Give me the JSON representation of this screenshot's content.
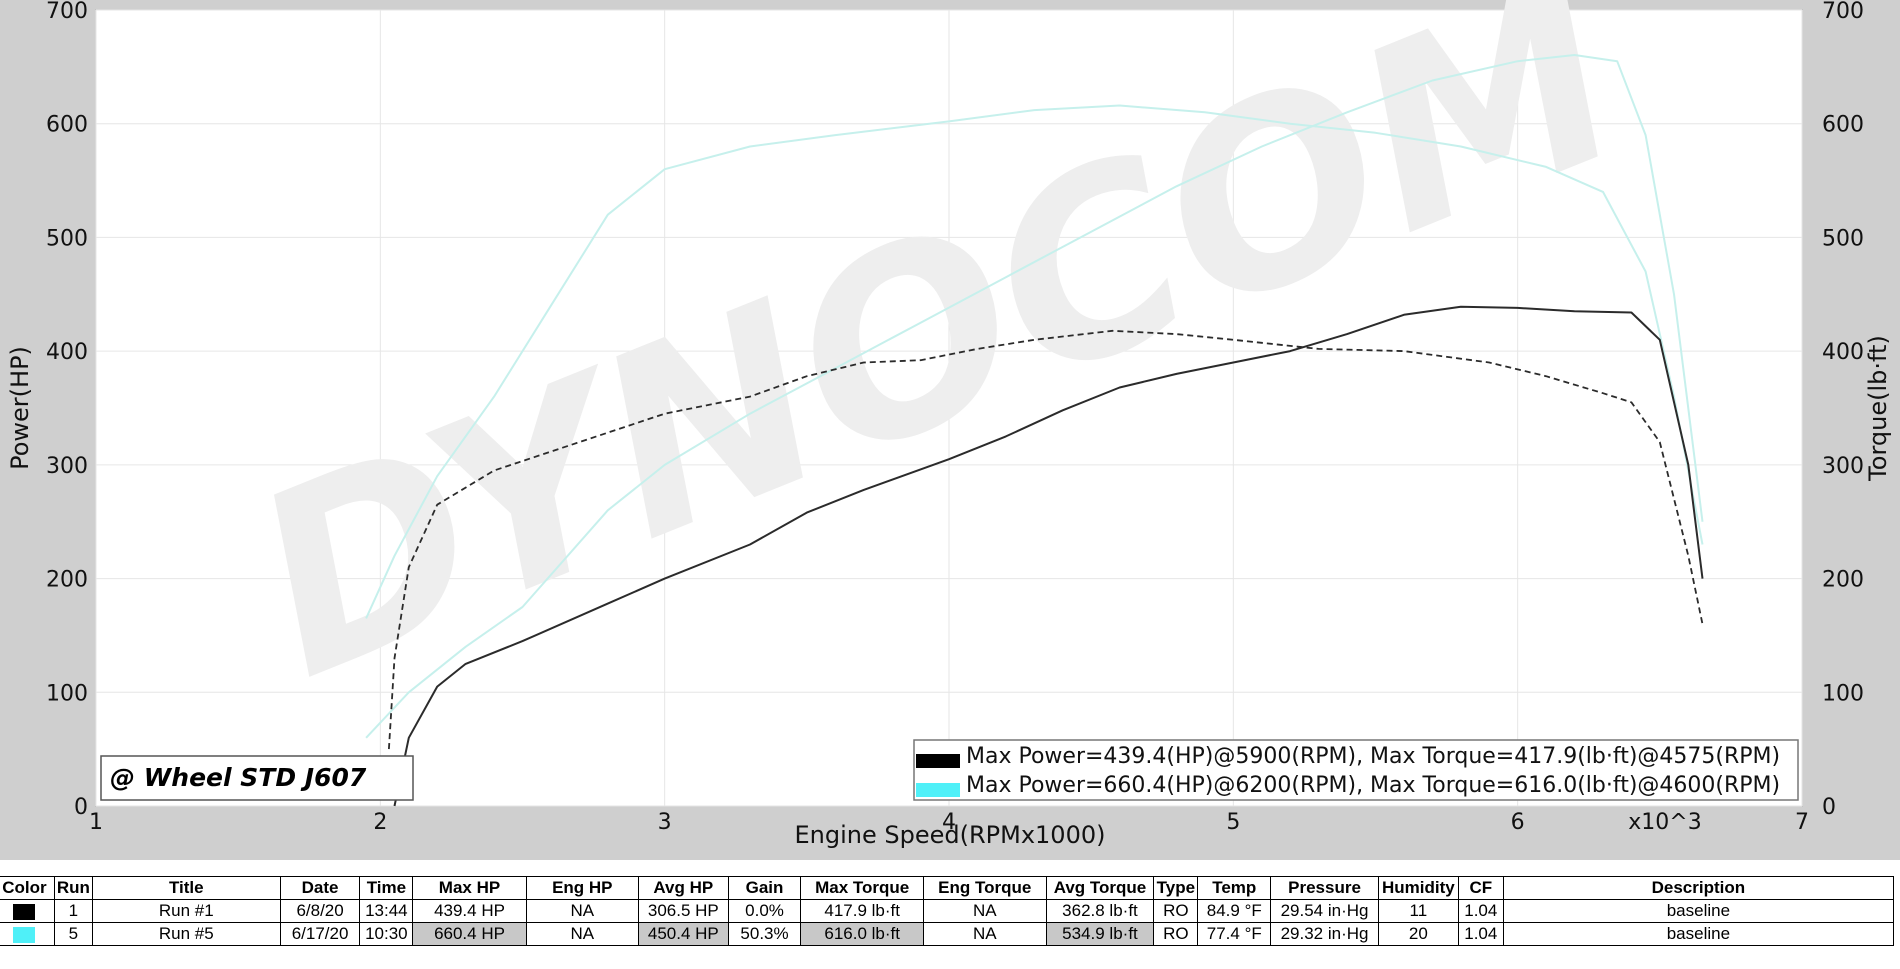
{
  "chart_data": {
    "type": "line",
    "title": "",
    "xlabel": "Engine Speed(RPMx1000)",
    "x_multiplier_label": "x10^3",
    "ylabel_left": "Power(HP)",
    "ylabel_right": "Torque(lb·ft)",
    "xlim": [
      1,
      7
    ],
    "ylim": [
      0,
      700
    ],
    "x_ticks": [
      "1",
      "2",
      "3",
      "4",
      "5",
      "6",
      "7"
    ],
    "y_ticks": [
      "0",
      "100",
      "200",
      "300",
      "400",
      "500",
      "600",
      "700"
    ],
    "grid": true,
    "watermark": "DYNOCOM",
    "corner_label": "@ Wheel STD J607",
    "legend_position": "bottom-right",
    "series": [
      {
        "name": "Run #1 Power (HP)",
        "color": "#2b2b2b",
        "style": "solid",
        "x": [
          2.05,
          2.1,
          2.2,
          2.3,
          2.5,
          2.8,
          3.0,
          3.3,
          3.5,
          3.7,
          4.0,
          4.2,
          4.4,
          4.6,
          4.8,
          5.0,
          5.2,
          5.4,
          5.6,
          5.8,
          6.0,
          6.2,
          6.4,
          6.5,
          6.6,
          6.65
        ],
        "y": [
          0,
          60,
          105,
          125,
          145,
          178,
          200,
          230,
          258,
          278,
          305,
          325,
          348,
          368,
          380,
          390,
          400,
          415,
          432,
          439,
          438,
          435,
          434,
          410,
          300,
          200
        ]
      },
      {
        "name": "Run #1 Torque (lb·ft)",
        "color": "#2b2b2b",
        "style": "dashed",
        "x": [
          2.03,
          2.05,
          2.1,
          2.2,
          2.4,
          2.7,
          3.0,
          3.3,
          3.5,
          3.7,
          3.9,
          4.1,
          4.3,
          4.575,
          4.8,
          5.0,
          5.3,
          5.6,
          5.9,
          6.1,
          6.3,
          6.4,
          6.5,
          6.6,
          6.65
        ],
        "y": [
          50,
          130,
          210,
          265,
          295,
          320,
          345,
          360,
          378,
          390,
          392,
          402,
          410,
          417.9,
          415,
          410,
          402,
          400,
          390,
          378,
          363,
          355,
          320,
          220,
          160
        ]
      },
      {
        "name": "Run #5 Power (HP)",
        "color": "#c6f0ec",
        "style": "solid",
        "x": [
          1.95,
          2.1,
          2.3,
          2.5,
          2.8,
          3.0,
          3.3,
          3.6,
          3.9,
          4.2,
          4.5,
          4.8,
          5.1,
          5.4,
          5.7,
          6.0,
          6.2,
          6.35,
          6.45,
          6.55,
          6.65
        ],
        "y": [
          60,
          100,
          140,
          175,
          260,
          300,
          345,
          385,
          425,
          465,
          505,
          545,
          580,
          610,
          638,
          655,
          660.4,
          655,
          590,
          450,
          250
        ]
      },
      {
        "name": "Run #5 Torque (lb·ft)",
        "color": "#c6f0ec",
        "style": "solid",
        "x": [
          1.95,
          2.05,
          2.2,
          2.4,
          2.6,
          2.8,
          3.0,
          3.3,
          3.6,
          4.0,
          4.3,
          4.6,
          4.9,
          5.2,
          5.5,
          5.8,
          6.1,
          6.3,
          6.45,
          6.55,
          6.65
        ],
        "y": [
          165,
          220,
          290,
          360,
          440,
          520,
          560,
          580,
          590,
          602,
          612,
          616,
          610,
          600,
          592,
          580,
          562,
          540,
          470,
          360,
          230
        ]
      }
    ],
    "legend_entries": [
      {
        "color": "#000000",
        "text": "Max Power=439.4(HP)@5900(RPM), Max Torque=417.9(lb·ft)@4575(RPM)"
      },
      {
        "color": "#4ff0f8",
        "text": "Max Power=660.4(HP)@6200(RPM), Max Torque=616.0(lb·ft)@4600(RPM)"
      }
    ]
  },
  "table": {
    "headers": [
      "Color",
      "Run",
      "Title",
      "Date",
      "Time",
      "Max HP",
      "Eng HP",
      "Avg HP",
      "Gain",
      "Max Torque",
      "Eng Torque",
      "Avg Torque",
      "Type",
      "Temp",
      "Pressure",
      "Humidity",
      "CF",
      "Description"
    ],
    "rows": [
      {
        "color": "#000000",
        "run": "1",
        "title": "Run #1",
        "date": "6/8/20",
        "time": "13:44",
        "max_hp": "439.4 HP",
        "eng_hp": "NA",
        "avg_hp": "306.5 HP",
        "gain": "0.0%",
        "max_torque": "417.9 lb·ft",
        "eng_torque": "NA",
        "avg_torque": "362.8 lb·ft",
        "type": "RO",
        "temp": "84.9 °F",
        "pressure": "29.54 in·Hg",
        "humidity": "11",
        "cf": "1.04",
        "description": "baseline",
        "highlight": false
      },
      {
        "color": "#4ff0f8",
        "run": "5",
        "title": "Run #5",
        "date": "6/17/20",
        "time": "10:30",
        "max_hp": "660.4 HP",
        "eng_hp": "NA",
        "avg_hp": "450.4 HP",
        "gain": "50.3%",
        "max_torque": "616.0 lb·ft",
        "eng_torque": "NA",
        "avg_torque": "534.9 lb·ft",
        "type": "RO",
        "temp": "77.4 °F",
        "pressure": "29.32 in·Hg",
        "humidity": "20",
        "cf": "1.04",
        "description": "baseline",
        "highlight": true
      }
    ]
  }
}
